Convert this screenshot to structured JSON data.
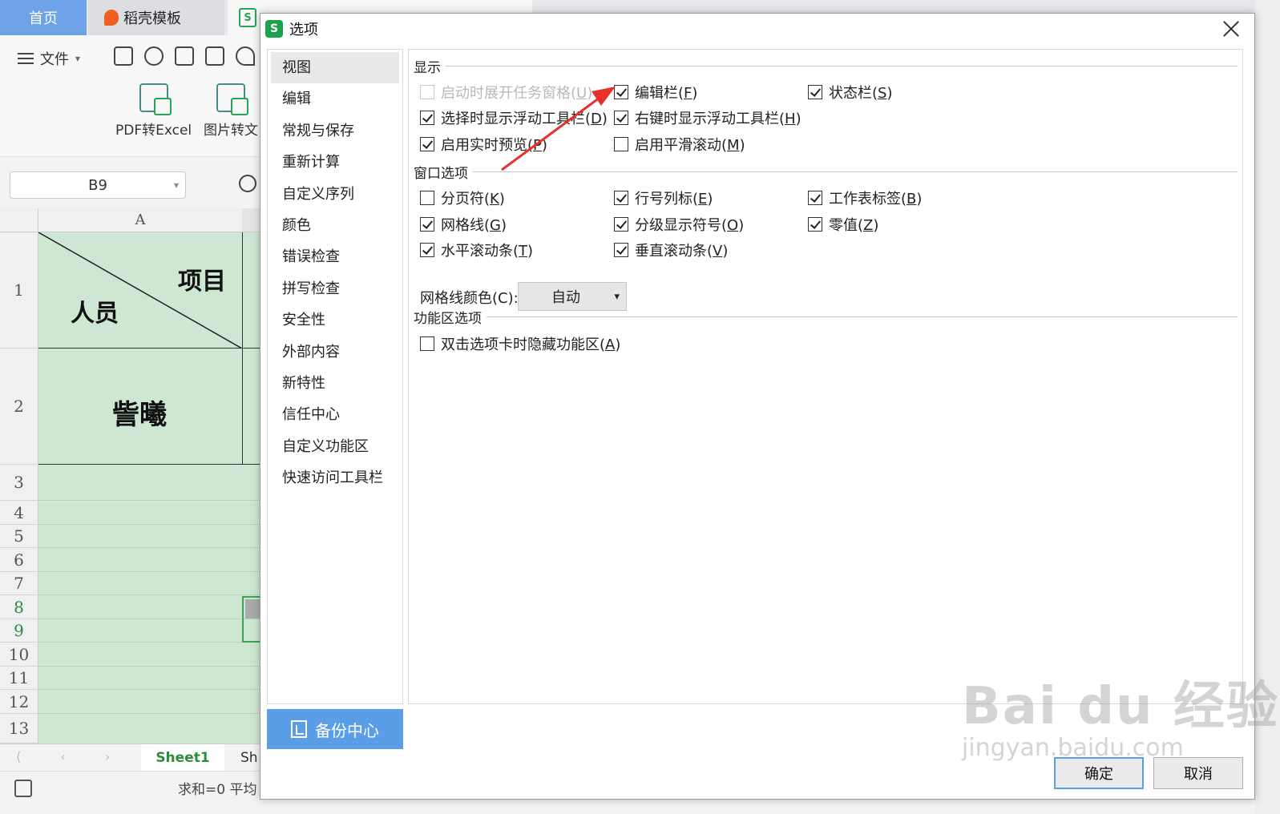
{
  "app": {
    "tabs": {
      "home": "首页",
      "docer": "稻壳模板"
    },
    "menu_file": "文件",
    "ribbon": {
      "pdf_to_excel": "PDF转Excel",
      "image_to_text": "图片转文"
    },
    "name_box": "B9",
    "column_a": "A",
    "rows": [
      "1",
      "2",
      "3",
      "4",
      "5",
      "6",
      "7",
      "8",
      "9",
      "10",
      "11",
      "12",
      "13"
    ],
    "cells": {
      "a1_top_right": "项目",
      "a1_bottom_left": "人员",
      "a2": "訾曦"
    },
    "sheet_tabs": {
      "active": "Sheet1",
      "next": "Sh"
    },
    "status": "求和=0  平均"
  },
  "dialog": {
    "title": "选项",
    "nav": [
      "视图",
      "编辑",
      "常规与保存",
      "重新计算",
      "自定义序列",
      "颜色",
      "错误检查",
      "拼写检查",
      "安全性",
      "外部内容",
      "新特性",
      "信任中心",
      "自定义功能区",
      "快速访问工具栏"
    ],
    "backup_center": "备份中心",
    "sections": {
      "display": "显示",
      "window": "窗口选项",
      "ribbon": "功能区选项"
    },
    "display_options": [
      {
        "label": "启动时展开任务窗格",
        "key": "U",
        "checked": false,
        "disabled": true
      },
      {
        "label": "编辑栏",
        "key": "F",
        "checked": true,
        "disabled": false
      },
      {
        "label": "状态栏",
        "key": "S",
        "checked": true,
        "disabled": false
      },
      {
        "label": "选择时显示浮动工具栏",
        "key": "D",
        "checked": true,
        "disabled": false
      },
      {
        "label": "右键时显示浮动工具栏",
        "key": "H",
        "checked": true,
        "disabled": false
      },
      {
        "label": "启用实时预览",
        "key": "P",
        "checked": true,
        "disabled": false
      },
      {
        "label": "启用平滑滚动",
        "key": "M",
        "checked": false,
        "disabled": false
      }
    ],
    "window_options": [
      {
        "label": "分页符",
        "key": "K",
        "checked": false
      },
      {
        "label": "行号列标",
        "key": "E",
        "checked": true
      },
      {
        "label": "工作表标签",
        "key": "B",
        "checked": true
      },
      {
        "label": "网格线",
        "key": "G",
        "checked": true
      },
      {
        "label": "分级显示符号",
        "key": "O",
        "checked": true
      },
      {
        "label": "零值",
        "key": "Z",
        "checked": true
      },
      {
        "label": "水平滚动条",
        "key": "T",
        "checked": true
      },
      {
        "label": "垂直滚动条",
        "key": "V",
        "checked": true
      }
    ],
    "grid_color_label": "网格线颜色(C):",
    "grid_color_value": "自动",
    "ribbon_options": [
      {
        "label": "双击选项卡时隐藏功能区",
        "key": "A",
        "checked": false
      }
    ],
    "ok": "确定",
    "cancel": "取消"
  },
  "annotation_color": "#e8302a",
  "watermark": {
    "main": "Bai du 经验",
    "sub": "jingyan.baidu.com"
  }
}
